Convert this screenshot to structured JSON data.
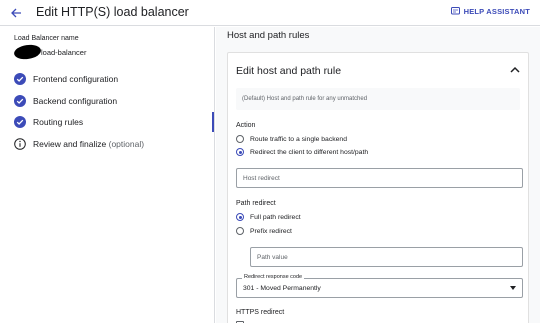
{
  "header": {
    "title": "Edit HTTP(S) load balancer",
    "help_label": "HELP ASSISTANT"
  },
  "sidebar": {
    "lb_name_label": "Load Balancer name",
    "lb_name_value": "load-balancer",
    "items": [
      {
        "label": "Frontend configuration",
        "optional": ""
      },
      {
        "label": "Backend configuration",
        "optional": ""
      },
      {
        "label": "Routing rules",
        "optional": ""
      },
      {
        "label": "Review and finalize",
        "optional": "(optional)"
      }
    ]
  },
  "main": {
    "section_title": "Host and path rules",
    "panel_title": "Edit host and path rule",
    "note": "(Default) Host and path rule for any unmatched",
    "action": {
      "label": "Action",
      "options": [
        "Route traffic to a single backend",
        "Redirect the client to different host/path"
      ],
      "selected_index": 1
    },
    "host_redirect_placeholder": "Host redirect",
    "path_redirect": {
      "label": "Path redirect",
      "options": [
        "Full path redirect",
        "Prefix redirect"
      ],
      "selected_index": 0
    },
    "path_value_placeholder": "Path value",
    "redirect_code": {
      "label": "Redirect response code",
      "value": "301 - Moved Permanently"
    },
    "https_redirect_label": "HTTPS redirect"
  },
  "colors": {
    "accent": "#3c4bb8",
    "border": "#dadce0",
    "panel_bg": "#f8f9fa"
  }
}
